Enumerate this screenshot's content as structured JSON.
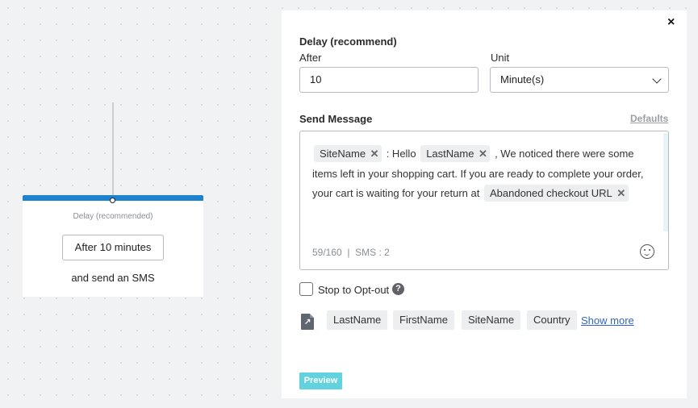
{
  "node": {
    "label": "Delay (recommended)",
    "button": "After 10 minutes",
    "subtitle": "and send an SMS"
  },
  "panel": {
    "close": "×",
    "section_title": "Delay (recommend)",
    "after_label": "After",
    "after_value": "10",
    "unit_label": "Unit",
    "unit_value": "Minute(s)",
    "send_message_label": "Send Message",
    "defaults_link": "Defaults",
    "message": {
      "tag1": "SiteName",
      "text1": ": Hello",
      "tag2": "LastName",
      "text2": ", We noticed there were some items left in your shopping cart. If you are ready to complete your order, your cart is waiting for your return at",
      "tag3": "Abandoned checkout URL",
      "remove_glyph": "✕"
    },
    "counter": "59/160  |  SMS : 2",
    "opt_out_label": "Stop to Opt-out",
    "help_glyph": "?",
    "variables": [
      "LastName",
      "FirstName",
      "SiteName",
      "Country"
    ],
    "show_more": "Show more",
    "preview_button": "Preview"
  },
  "icons": {
    "close": "close-icon",
    "chevron": "chevron-down-icon",
    "remove": "remove-tag-icon",
    "emoji": "smiley-icon",
    "help": "help-icon",
    "file": "variable-file-icon"
  },
  "colors": {
    "node_accent": "#1e83cf",
    "preview": "#62d3de",
    "link": "#3465c4"
  }
}
